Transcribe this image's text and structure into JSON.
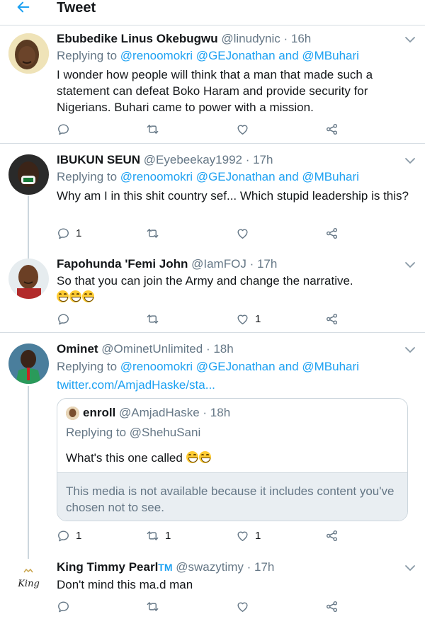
{
  "header": {
    "title": "Tweet",
    "back_icon": "arrow-left-icon"
  },
  "colors": {
    "accent": "#1da1f2",
    "secondary_text": "#657786",
    "divider": "#d6dde3"
  },
  "tweets": [
    {
      "name": "Ebubedike Linus Okebugwu",
      "handle": "@linudynic",
      "time": "· 16h",
      "replying_to_label": "Replying to",
      "replying_to_mentions": "@renoomokri @GEJonathan and @MBuhari",
      "text": "I wonder how people will think that a man that made such a statement can defeat Boko Haram and provide security for Nigerians. Buhari came to power with a mission.",
      "reply_count": "",
      "retweet_count": "",
      "like_count": ""
    },
    {
      "name": "IBUKUN SEUN",
      "handle": "@Eyebeekay1992",
      "time": "· 17h",
      "replying_to_label": "Replying to",
      "replying_to_mentions": "@renoomokri @GEJonathan and @MBuhari",
      "text": "Why am I in this shit country sef... Which stupid leadership is this?",
      "reply_count": "1",
      "retweet_count": "",
      "like_count": ""
    },
    {
      "name": "Fapohunda 'Femi John",
      "handle": "@IamFOJ",
      "time": "· 17h",
      "text": "So that you can join the Army and change the narrative.",
      "emoji_count": 3,
      "emoji_icon": "tears-of-joy-emoji",
      "reply_count": "",
      "retweet_count": "",
      "like_count": "1"
    },
    {
      "name": "Ominet",
      "handle": "@OminetUnlimited",
      "time": "· 18h",
      "replying_to_label": "Replying to",
      "replying_to_mentions": "@renoomokri @GEJonathan and @MBuhari",
      "link": "twitter.com/AmjadHaske/sta...",
      "quote": {
        "name": "enroll",
        "handle": "@AmjadHaske",
        "time": "· 18h",
        "replying_to_label": "Replying to",
        "replying_to_mentions": "@ShehuSani",
        "text": "What's this one called",
        "emoji_count": 2,
        "media_notice": "This media is not available because it includes content you've chosen not to see."
      },
      "reply_count": "1",
      "retweet_count": "1",
      "like_count": "1"
    },
    {
      "name": "King Timmy Pearl",
      "name_badge": "TM",
      "handle": "@swazytimy",
      "time": "· 17h",
      "avatar_text": "King",
      "text": "Don't mind this ma.d man",
      "reply_count": "",
      "retweet_count": "",
      "like_count": ""
    }
  ]
}
